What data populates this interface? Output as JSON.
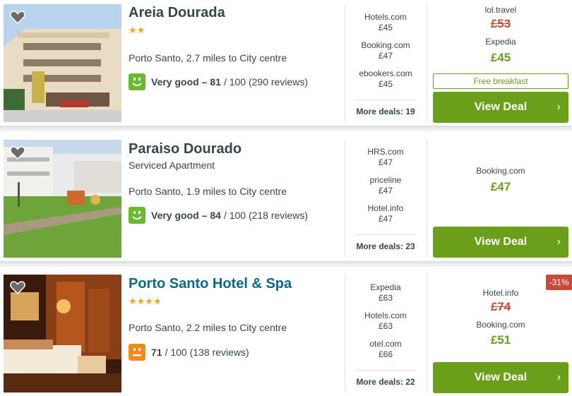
{
  "hotels": [
    {
      "name": "Areia Dourada",
      "stars": "★★",
      "subtype": "",
      "location": "Porto Santo, 2.7 miles to City centre",
      "rating": {
        "label": "Very good –",
        "score": "81",
        "rest": "/ 100 (290 reviews)",
        "color": "#6ab92e",
        "mood": "smile"
      },
      "deals": [
        {
          "site": "Hotels.com",
          "price": "£45"
        },
        {
          "site": "Booking.com",
          "price": "£47"
        },
        {
          "site": "ebookers.com",
          "price": "£45"
        }
      ],
      "more_deals": "More deals: 19",
      "best": {
        "old_site": "lol.travel",
        "old_price": "£53",
        "site": "Expedia",
        "price": "£45",
        "perk": "Free breakfast"
      },
      "cta": "View Deal"
    },
    {
      "name": "Paraiso Dourado",
      "stars": "",
      "subtype": "Serviced Apartment",
      "location": "Porto Santo, 1.9 miles to City centre",
      "rating": {
        "label": "Very good –",
        "score": "84",
        "rest": "/ 100 (218 reviews)",
        "color": "#6ab92e",
        "mood": "smile"
      },
      "deals": [
        {
          "site": "HRS.com",
          "price": "£47"
        },
        {
          "site": "priceline",
          "price": "£47"
        },
        {
          "site": "Hotel.info",
          "price": "£47"
        }
      ],
      "more_deals": "More deals: 23",
      "best": {
        "site": "Booking.com",
        "price": "£47"
      },
      "cta": "View Deal"
    },
    {
      "name": "Porto Santo Hotel & Spa",
      "stars": "★★★★",
      "subtype": "",
      "location": "Porto Santo, 2.2 miles to City centre",
      "rating": {
        "label": "",
        "score": "71",
        "rest": "/ 100 (138 reviews)",
        "color": "#f08a1d",
        "mood": "neutral"
      },
      "deals": [
        {
          "site": "Expedia",
          "price": "£63"
        },
        {
          "site": "Hotels.com",
          "price": "£63"
        },
        {
          "site": "otel.com",
          "price": "£66"
        }
      ],
      "more_deals": "More deals: 22",
      "best": {
        "old_site": "Hotel.info",
        "old_price": "£74",
        "site": "Booking.com",
        "price": "£51",
        "discount": "-31%"
      },
      "cta": "View Deal"
    }
  ],
  "icons": {
    "favorite": "heart-icon",
    "chevron": "chevron-right-icon",
    "rating": "smiley-icon"
  },
  "colors": {
    "accent_green": "#6b9f19",
    "price_green": "#6a9e1f",
    "strike_red": "#c94a38",
    "star": "#f2a81d",
    "link": "#0a6a8a"
  }
}
